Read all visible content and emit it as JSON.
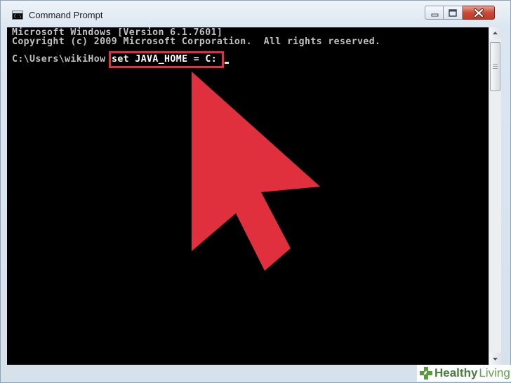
{
  "window": {
    "title": "Command Prompt",
    "icon_label": "C:\\"
  },
  "icons": {
    "app": "cmd-icon",
    "minimize": "minimize-icon",
    "maximize": "maximize-icon",
    "close": "close-icon",
    "scroll_up": "scroll-up-icon",
    "scroll_down": "scroll-down-icon",
    "pointer": "red-cursor-arrow-icon",
    "watermark": "healthy-living-logo-icon"
  },
  "console": {
    "lines": [
      "Microsoft Windows [Version 6.1.7601]",
      "Copyright (c) 2009 Microsoft Corporation.  All rights reserved.",
      "",
      "C:\\Users\\wikiHow"
    ],
    "highlighted_command": "set JAVA_HOME = C:"
  },
  "colors": {
    "highlight": "#e0303e",
    "arrow": "#e0303e",
    "console_bg": "#000000",
    "console_fg": "#c0c0c0"
  },
  "watermark": {
    "brand": "Healthy",
    "brand_suffix": "Living"
  }
}
